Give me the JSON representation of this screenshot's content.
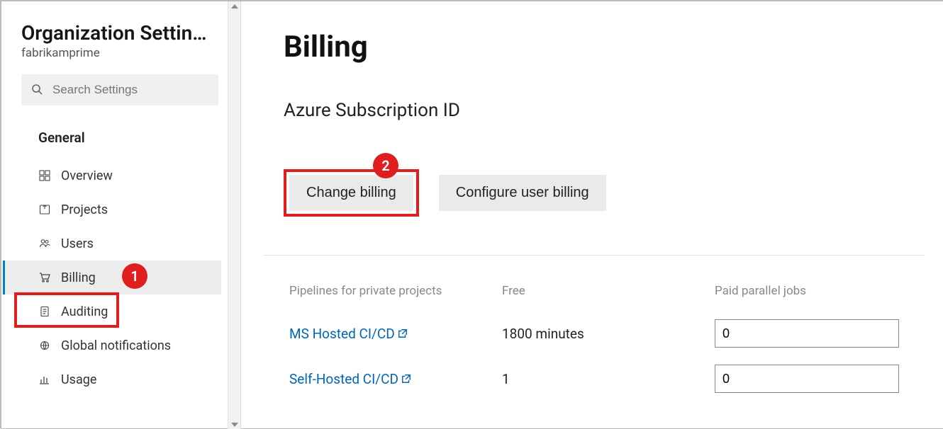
{
  "sidebar": {
    "title": "Organization Settin…",
    "subtitle": "fabrikamprime",
    "search_placeholder": "Search Settings",
    "section_label": "General",
    "items": [
      {
        "label": "Overview",
        "icon": "overview-icon"
      },
      {
        "label": "Projects",
        "icon": "projects-icon"
      },
      {
        "label": "Users",
        "icon": "users-icon"
      },
      {
        "label": "Billing",
        "icon": "cart-icon",
        "selected": true
      },
      {
        "label": "Auditing",
        "icon": "auditing-icon"
      },
      {
        "label": "Global notifications",
        "icon": "notifications-icon"
      },
      {
        "label": "Usage",
        "icon": "usage-icon"
      }
    ]
  },
  "callouts": {
    "one": "1",
    "two": "2"
  },
  "main": {
    "heading": "Billing",
    "subheading": "Azure Subscription ID",
    "buttons": {
      "change_billing": "Change billing",
      "configure_user_billing": "Configure user billing"
    },
    "table": {
      "headers": {
        "pipelines": "Pipelines for private projects",
        "free": "Free",
        "paid": "Paid parallel jobs"
      },
      "rows": [
        {
          "name": "MS Hosted CI/CD",
          "free": "1800 minutes",
          "paid_value": "0"
        },
        {
          "name": "Self-Hosted CI/CD",
          "free": "1",
          "paid_value": "0"
        }
      ]
    }
  }
}
